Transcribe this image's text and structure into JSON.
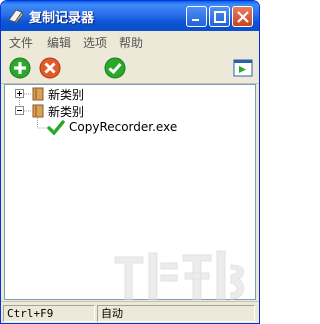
{
  "window": {
    "title": "复制记录器"
  },
  "menu": [
    {
      "label": "文件"
    },
    {
      "label": "编辑"
    },
    {
      "label": "选项"
    },
    {
      "label": "帮助"
    }
  ],
  "toolbar": {
    "buttons": [
      {
        "name": "add",
        "icon": "plus-icon",
        "color": "#2aa829"
      },
      {
        "name": "delete",
        "icon": "x-icon",
        "color": "#e35a2a"
      },
      {
        "name": "confirm",
        "icon": "check-icon",
        "color": "#2aa829"
      },
      {
        "name": "run",
        "icon": "play-window-icon"
      }
    ]
  },
  "tree": {
    "nodes": [
      {
        "label": "新类别",
        "expanded": false
      },
      {
        "label": "新类别",
        "expanded": true,
        "children": [
          {
            "label": "CopyRecorder.exe"
          }
        ]
      }
    ]
  },
  "status": {
    "shortcut": "Ctrl+F9",
    "mode": "自动"
  }
}
